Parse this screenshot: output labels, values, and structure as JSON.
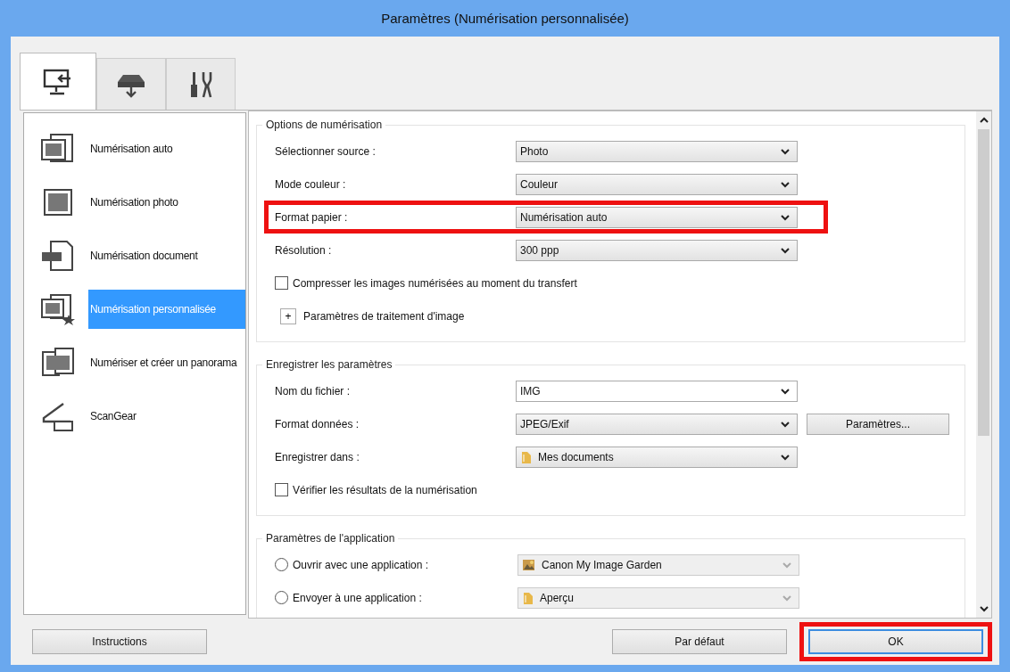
{
  "window": {
    "title": "Paramètres (Numérisation personnalisée)"
  },
  "tabs": [
    {
      "kind": "scan-computer",
      "selected": true
    },
    {
      "kind": "scanner",
      "selected": false
    },
    {
      "kind": "tools",
      "selected": false
    }
  ],
  "sidebar": {
    "items": [
      {
        "kind": "auto",
        "label": "Numérisation auto",
        "selected": false
      },
      {
        "kind": "photo",
        "label": "Numérisation photo",
        "selected": false
      },
      {
        "kind": "document",
        "label": "Numérisation document",
        "selected": false
      },
      {
        "kind": "custom",
        "label": "Numérisation personnalisée",
        "selected": true
      },
      {
        "kind": "panorama",
        "label": "Numériser et créer un panorama",
        "selected": false
      },
      {
        "kind": "scangear",
        "label": "ScanGear",
        "selected": false
      }
    ]
  },
  "groups": [
    {
      "title": "Options de numérisation",
      "rows": [
        {
          "kind": "select",
          "label": "Sélectionner source :",
          "value": "Photo",
          "highlighted": false
        },
        {
          "kind": "select",
          "label": "Mode couleur :",
          "value": "Couleur",
          "highlighted": false
        },
        {
          "kind": "select",
          "label": "Format papier :",
          "value": "Numérisation auto",
          "highlighted": true
        },
        {
          "kind": "select",
          "label": "Résolution :",
          "value": "300 ppp",
          "highlighted": false
        },
        {
          "kind": "checkbox",
          "label": "Compresser les images numérisées au moment du transfert",
          "checked": false
        },
        {
          "kind": "expand",
          "label": "Paramètres de traitement d'image",
          "expand_symbol": "+",
          "expanded": false
        }
      ]
    },
    {
      "title": "Enregistrer les paramètres",
      "rows": [
        {
          "kind": "select",
          "label": "Nom du fichier :",
          "value": "IMG",
          "editable": true,
          "highlighted": false
        },
        {
          "kind": "select",
          "label": "Format données :",
          "value": "JPEG/Exif",
          "button": "Paramètres...",
          "highlighted": false
        },
        {
          "kind": "select",
          "label": "Enregistrer dans :",
          "value": "Mes documents",
          "highlighted": false
        },
        {
          "kind": "checkbox",
          "label": "Vérifier les résultats de la numérisation",
          "checked": false
        }
      ]
    },
    {
      "title": "Paramètres de l'application",
      "rows": [
        {
          "kind": "radio",
          "label": "Ouvrir avec une application :",
          "selected": false,
          "value": "Canon My Image Garden",
          "disabled": true
        },
        {
          "kind": "radio",
          "label": "Envoyer à une application :",
          "selected": false,
          "value": "Aperçu",
          "disabled": true
        }
      ]
    }
  ],
  "buttons": [
    {
      "label": "Instructions",
      "highlighted": false
    },
    {
      "label": "Par défaut",
      "highlighted": false
    },
    {
      "label": "OK",
      "highlighted": true,
      "default": true
    }
  ]
}
